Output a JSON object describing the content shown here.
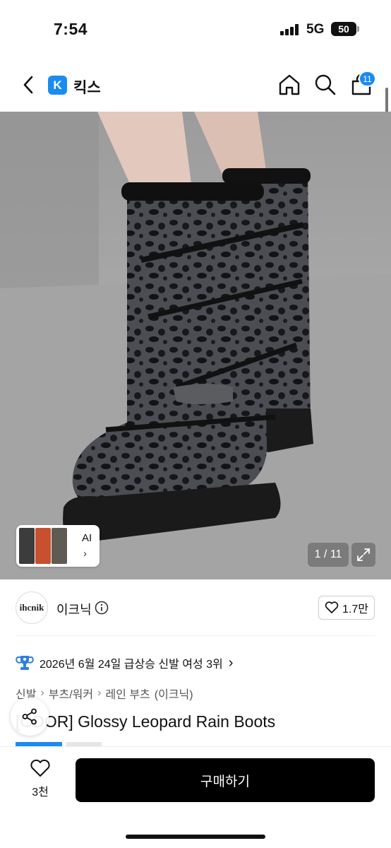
{
  "status_bar": {
    "time": "7:54",
    "network": "5G",
    "battery": "50"
  },
  "header": {
    "back_icon": "chevron-left-icon",
    "logo_letter": "K",
    "title": "킥스",
    "icons": [
      "home-icon",
      "search-icon",
      "shopping-bag-icon"
    ],
    "cart_badge": "11",
    "accent_color": "#1a8cf0"
  },
  "gallery": {
    "counter": "1 / 11",
    "ai_label": "AI",
    "ai_chevron": "›",
    "expand_icon": "expand-icon"
  },
  "shop": {
    "avatar_text": "ihcnik",
    "name": "이크닉",
    "like_count": "1.7만"
  },
  "ranking": {
    "text": "2026년 6월 24일 급상승 신발 여성 3위",
    "chevron": "›"
  },
  "breadcrumb": [
    "신발",
    "부츠/워커",
    "레인 부츠",
    "(이크닉)"
  ],
  "product": {
    "title": "[ODOR] Glossy Leopard Rain Boots"
  },
  "bottom_bar": {
    "like_count": "3천",
    "buy_label": "구매하기"
  }
}
